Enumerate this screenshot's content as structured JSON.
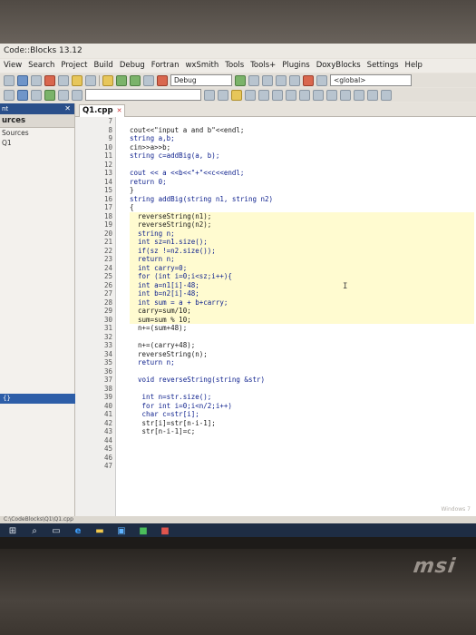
{
  "window": {
    "title": "Code::Blocks 13.12"
  },
  "menu": [
    "View",
    "Search",
    "Project",
    "Build",
    "Debug",
    "Fortran",
    "wxSmith",
    "Tools",
    "Tools+",
    "Plugins",
    "DoxyBlocks",
    "Settings",
    "Help"
  ],
  "toolbar": {
    "build_target": "Debug",
    "scope": "<global>"
  },
  "left_panel": {
    "header": "nt",
    "tab": "urces",
    "items": [
      "Sources",
      "Q1"
    ],
    "bottom_label": "{}"
  },
  "editor": {
    "file_tab": "Q1.cpp",
    "lines": [
      {
        "n": "7",
        "text": ""
      },
      {
        "n": "8",
        "text": "cout<<\"input a and b\"<<endl;"
      },
      {
        "n": "9",
        "text": "string a,b;"
      },
      {
        "n": "10",
        "text": "cin>>a>>b;"
      },
      {
        "n": "11",
        "text": "string c=addBig(a, b);"
      },
      {
        "n": "12",
        "text": ""
      },
      {
        "n": "13",
        "text": "cout << a <<b<<\"+\"<<c<<endl;"
      },
      {
        "n": "14",
        "text": "return 0;"
      },
      {
        "n": "15",
        "text": "}"
      },
      {
        "n": "16",
        "text": "string addBig(string n1, string n2)"
      },
      {
        "n": "17",
        "text": "{"
      },
      {
        "n": "18",
        "text": "  reverseString(n1);"
      },
      {
        "n": "19",
        "text": "  reverseString(n2);"
      },
      {
        "n": "20",
        "text": "  string n;"
      },
      {
        "n": "21",
        "text": "  int sz=n1.size();"
      },
      {
        "n": "22",
        "text": "  if(sz !=n2.size());"
      },
      {
        "n": "23",
        "text": "  return n;"
      },
      {
        "n": "24",
        "text": "  int carry=0;"
      },
      {
        "n": "25",
        "text": "  for (int i=0;i<sz;i++){"
      },
      {
        "n": "26",
        "text": "  int a=n1[i]-48;"
      },
      {
        "n": "27",
        "text": "  int b=n2[i]-48;"
      },
      {
        "n": "28",
        "text": "  int sum = a + b+carry;"
      },
      {
        "n": "29",
        "text": "  carry=sum/10;"
      },
      {
        "n": "30",
        "text": "  sum=sum % 10;"
      },
      {
        "n": "31",
        "text": "  n+=(sum+48);"
      },
      {
        "n": "32",
        "text": ""
      },
      {
        "n": "33",
        "text": "  n+=(carry+48);"
      },
      {
        "n": "34",
        "text": "  reverseString(n);"
      },
      {
        "n": "35",
        "text": "  return n;"
      },
      {
        "n": "36",
        "text": ""
      },
      {
        "n": "37",
        "text": "  void reverseString(string &str)"
      },
      {
        "n": "38",
        "text": ""
      },
      {
        "n": "39",
        "text": "   int n=str.size();"
      },
      {
        "n": "40",
        "text": "   for int i=0;i<n/2;i++)"
      },
      {
        "n": "41",
        "text": "   char c=str[i];"
      },
      {
        "n": "42",
        "text": "   str[i]=str[n-i-1];"
      },
      {
        "n": "43",
        "text": "   str[n-i-1]=c;"
      },
      {
        "n": "44",
        "text": ""
      },
      {
        "n": "45",
        "text": ""
      },
      {
        "n": "46",
        "text": ""
      },
      {
        "n": "47",
        "text": ""
      }
    ],
    "watermark": "Windows 7"
  },
  "statusbar": {
    "path": "C:\\CodeBlocks\\Q1\\Q1.cpp"
  },
  "monitor": {
    "brand": "msi"
  }
}
